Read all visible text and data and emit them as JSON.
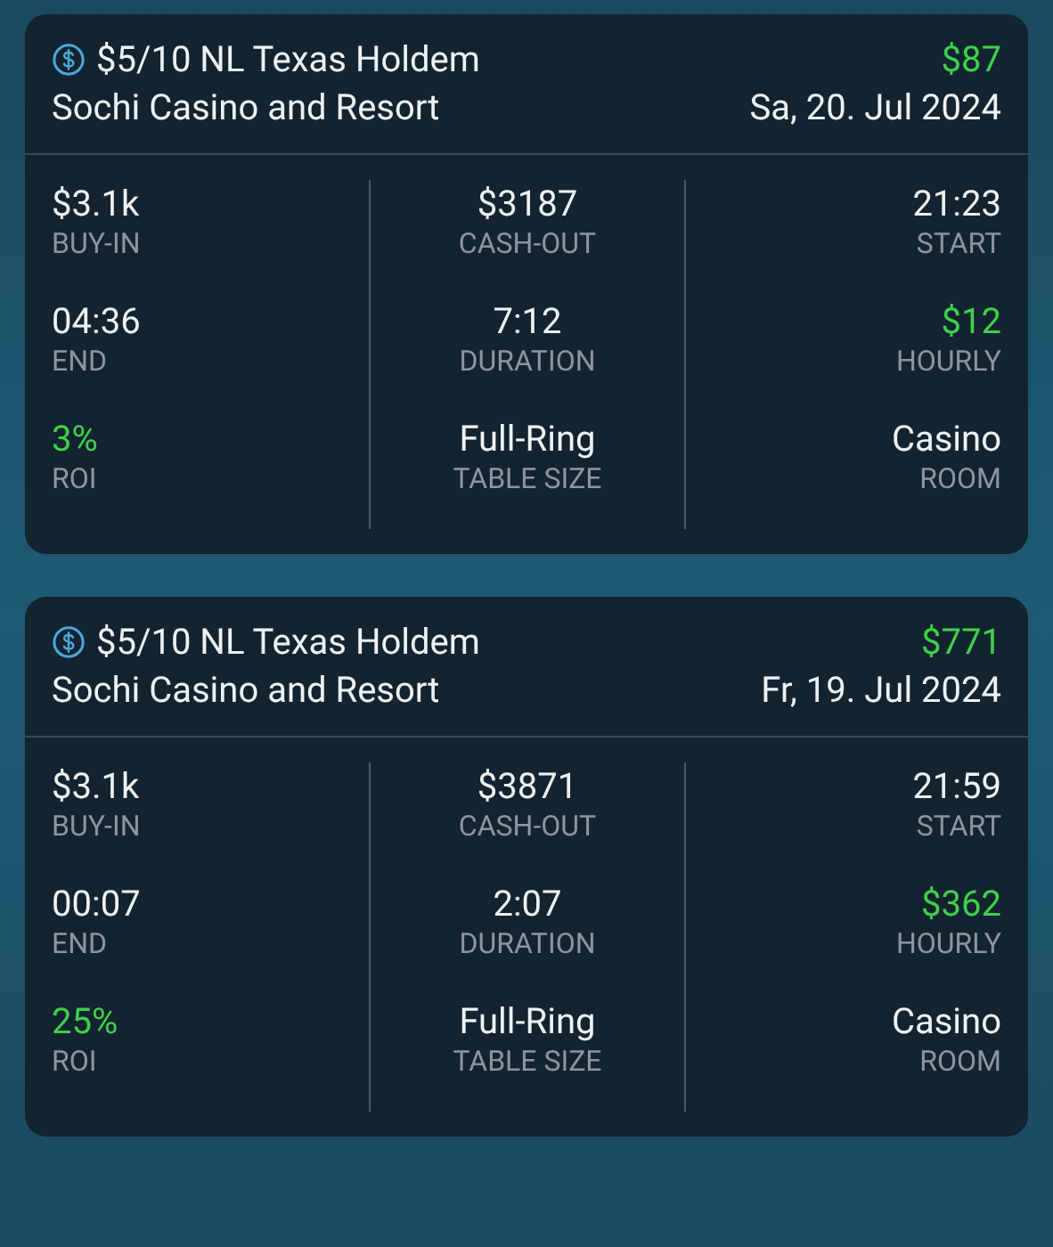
{
  "sessions": [
    {
      "game": "$5/10 NL Texas Holdem",
      "venue": "Sochi Casino and Resort",
      "result": "$87",
      "result_positive": true,
      "date": "Sa, 20. Jul 2024",
      "stats": [
        {
          "value": "$3.1k",
          "label": "BUY-IN",
          "positive": false
        },
        {
          "value": "$3187",
          "label": "CASH-OUT",
          "positive": false
        },
        {
          "value": "21:23",
          "label": "START",
          "positive": false
        },
        {
          "value": "04:36",
          "label": "END",
          "positive": false
        },
        {
          "value": "7:12",
          "label": "DURATION",
          "positive": false
        },
        {
          "value": "$12",
          "label": "HOURLY",
          "positive": true
        },
        {
          "value": "3%",
          "label": "ROI",
          "positive": true
        },
        {
          "value": "Full-Ring",
          "label": "TABLE SIZE",
          "positive": false
        },
        {
          "value": "Casino",
          "label": "ROOM",
          "positive": false
        }
      ]
    },
    {
      "game": "$5/10 NL Texas Holdem",
      "venue": "Sochi Casino and Resort",
      "result": "$771",
      "result_positive": true,
      "date": "Fr, 19. Jul 2024",
      "stats": [
        {
          "value": "$3.1k",
          "label": "BUY-IN",
          "positive": false
        },
        {
          "value": "$3871",
          "label": "CASH-OUT",
          "positive": false
        },
        {
          "value": "21:59",
          "label": "START",
          "positive": false
        },
        {
          "value": "00:07",
          "label": "END",
          "positive": false
        },
        {
          "value": "2:07",
          "label": "DURATION",
          "positive": false
        },
        {
          "value": "$362",
          "label": "HOURLY",
          "positive": true
        },
        {
          "value": "25%",
          "label": "ROI",
          "positive": true
        },
        {
          "value": "Full-Ring",
          "label": "TABLE SIZE",
          "positive": false
        },
        {
          "value": "Casino",
          "label": "ROOM",
          "positive": false
        }
      ]
    }
  ]
}
